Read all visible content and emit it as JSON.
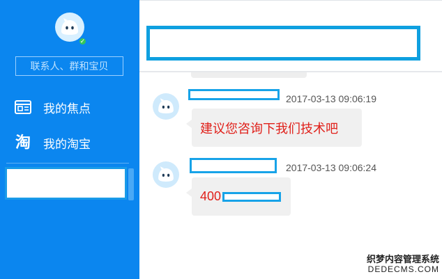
{
  "sidebar": {
    "search_placeholder": "联系人、群和宝贝",
    "nav": [
      {
        "label": "我的焦点",
        "icon": "focus-card-icon"
      },
      {
        "label": "我的淘宝",
        "icon": "taobao-icon"
      }
    ],
    "taobao_glyph": "淘",
    "online_status": "online"
  },
  "chat": {
    "messages": [
      {
        "time": "2017-03-13 09:06:19",
        "text": "建议您咨询下我们技术吧"
      },
      {
        "time": "2017-03-13 09:06:24",
        "text": "400"
      }
    ]
  },
  "watermark": {
    "line1": "织梦内容管理系统",
    "line2": "DEDECMS.COM"
  },
  "colors": {
    "sidebar_bg": "#0b86ef",
    "redaction_border": "#0fa0e0",
    "message_text": "#e0201a",
    "bubble_bg": "#f0f0f0"
  }
}
